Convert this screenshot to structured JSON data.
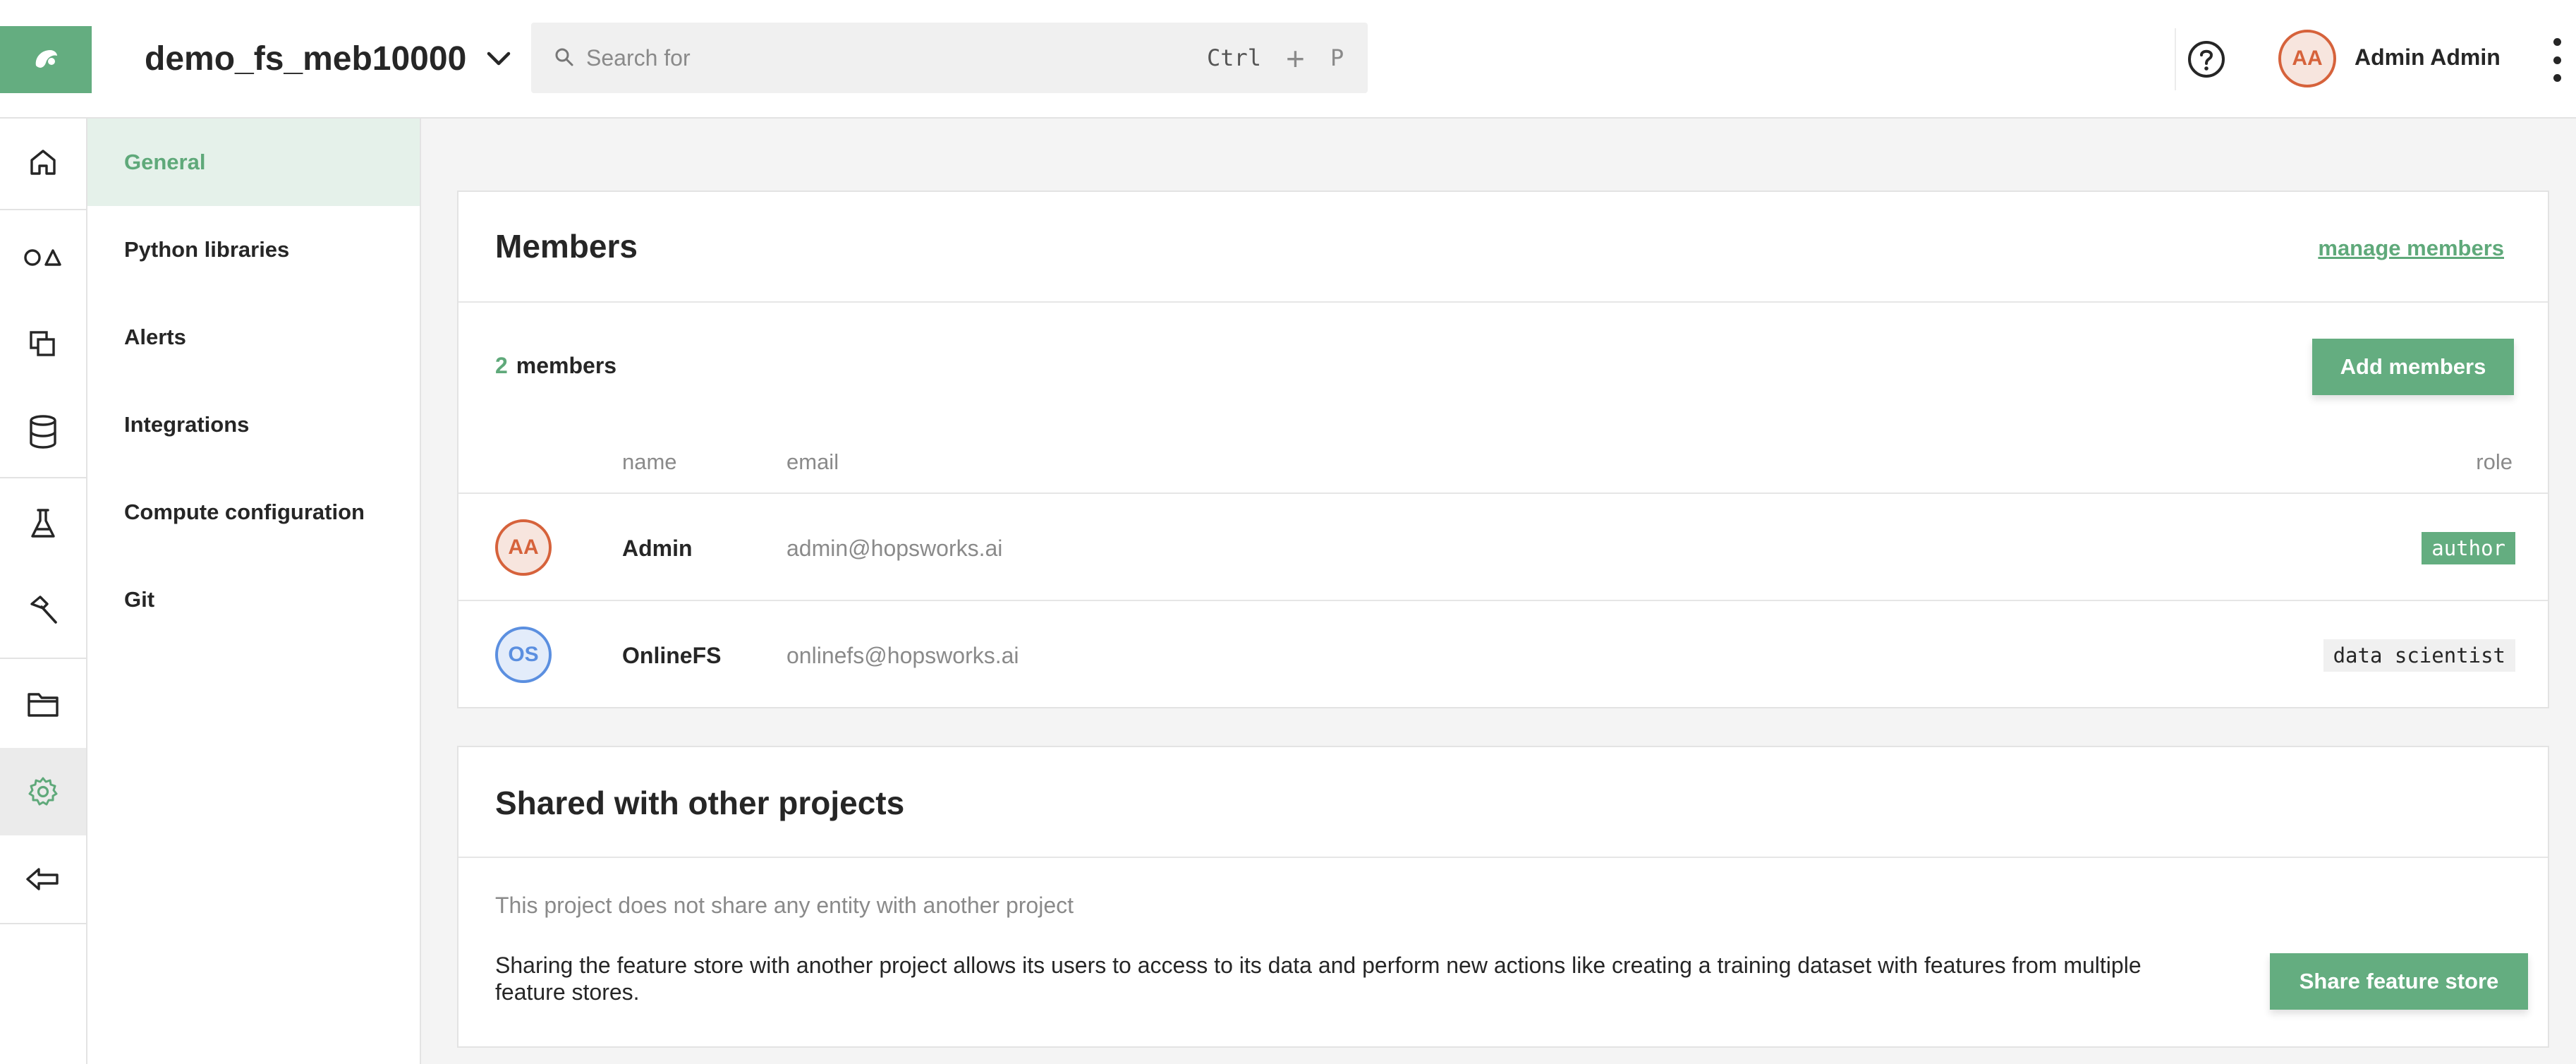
{
  "header": {
    "project_name": "demo_fs_meb10000",
    "search_placeholder": "Search for",
    "shortcut_ctrl": "Ctrl",
    "shortcut_plus": "+",
    "shortcut_key": "P",
    "user_initials": "AA",
    "user_name": "Admin Admin"
  },
  "icon_sidebar": {
    "items": [
      {
        "icon": "home-icon"
      },
      {
        "icon": "shapes-icon"
      },
      {
        "icon": "copy-icon"
      },
      {
        "icon": "database-icon"
      },
      {
        "icon": "flask-icon"
      },
      {
        "icon": "hammer-icon"
      },
      {
        "icon": "folder-icon"
      },
      {
        "icon": "gear-icon",
        "active": true
      },
      {
        "icon": "back-arrow-icon"
      }
    ]
  },
  "settings_menu": {
    "items": [
      {
        "label": "General",
        "active": true
      },
      {
        "label": "Python libraries"
      },
      {
        "label": "Alerts"
      },
      {
        "label": "Integrations"
      },
      {
        "label": "Compute configuration"
      },
      {
        "label": "Git"
      }
    ]
  },
  "members": {
    "title": "Members",
    "manage_link": "manage members",
    "count": "2",
    "count_label": "members",
    "add_button": "Add members",
    "columns": {
      "name": "name",
      "email": "email",
      "role": "role"
    },
    "rows": [
      {
        "initials": "AA",
        "name": "Admin",
        "email": "admin@hopsworks.ai",
        "role": "author",
        "avatar_color": "#d6623b"
      },
      {
        "initials": "OS",
        "name": "OnlineFS",
        "email": "onlinefs@hopsworks.ai",
        "role": "data scientist",
        "avatar_color": "#5b8fe0"
      }
    ]
  },
  "shared": {
    "title": "Shared with other projects",
    "empty_text": "This project does not share any entity with another project",
    "description": "Sharing the feature store with another project allows its users to access to its data and perform new actions like creating a training dataset with features from multiple feature stores.",
    "share_button": "Share feature store"
  },
  "colors": {
    "accent": "#64ad80",
    "accent_text": "#5fa97a",
    "active_menu_bg": "#e5f1ea",
    "orange": "#d6623b",
    "blue": "#5b8fe0"
  }
}
